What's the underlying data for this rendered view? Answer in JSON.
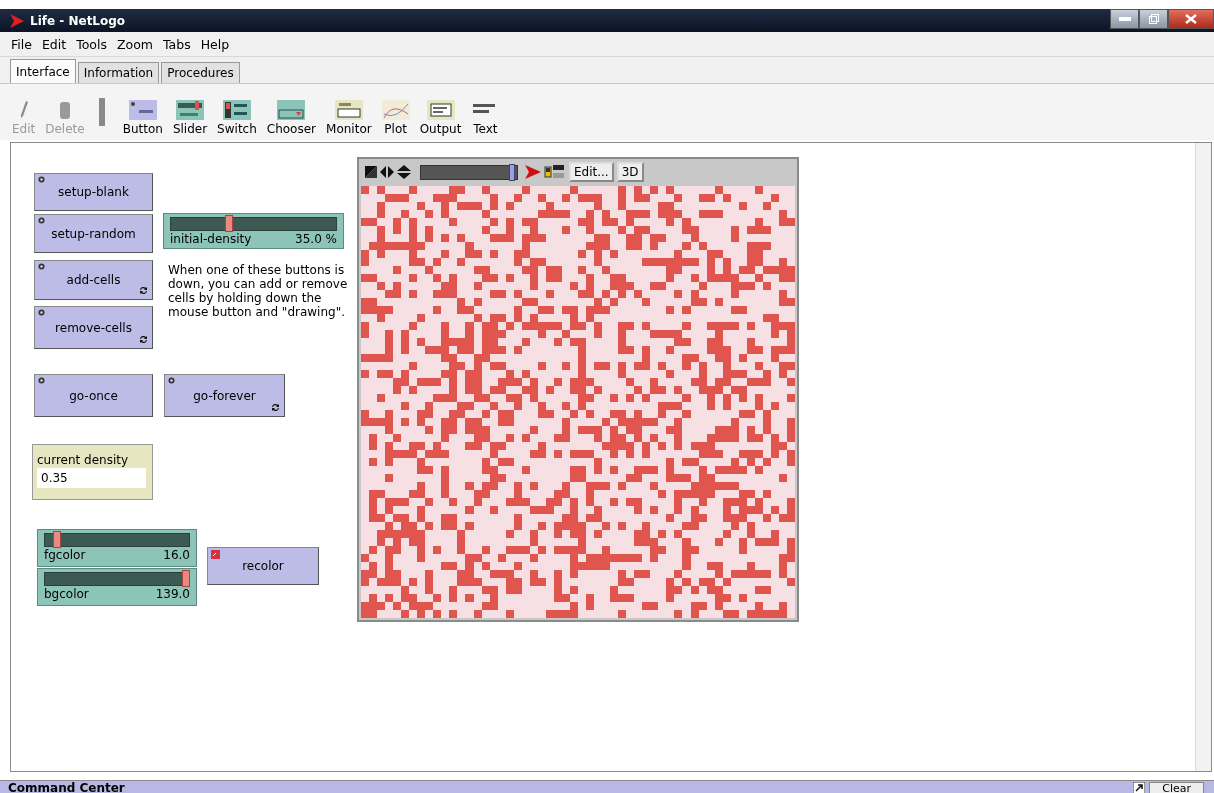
{
  "window": {
    "title": "Life - NetLogo"
  },
  "menu": [
    "File",
    "Edit",
    "Tools",
    "Zoom",
    "Tabs",
    "Help"
  ],
  "tabs": [
    {
      "label": "Interface",
      "selected": true
    },
    {
      "label": "Information",
      "selected": false
    },
    {
      "label": "Procedures",
      "selected": false
    }
  ],
  "toolbar": [
    {
      "kind": "edit",
      "label": "Edit",
      "disabled": true
    },
    {
      "kind": "delete",
      "label": "Delete",
      "disabled": true
    },
    {
      "kind": "button",
      "label": "Button",
      "disabled": false
    },
    {
      "kind": "slider",
      "label": "Slider",
      "disabled": false
    },
    {
      "kind": "switch",
      "label": "Switch",
      "disabled": false
    },
    {
      "kind": "chooser",
      "label": "Chooser",
      "disabled": false
    },
    {
      "kind": "monitor",
      "label": "Monitor",
      "disabled": false
    },
    {
      "kind": "plot",
      "label": "Plot",
      "disabled": false
    },
    {
      "kind": "output",
      "label": "Output",
      "disabled": false
    },
    {
      "kind": "text",
      "label": "Text",
      "disabled": false
    }
  ],
  "widgets": [
    {
      "kind": "button",
      "label": "setup-blank",
      "patches": false,
      "forever": false
    },
    {
      "kind": "button",
      "label": "setup-random",
      "patches": false,
      "forever": false
    },
    {
      "kind": "slider",
      "label": "initial-density",
      "value": "35.0 %",
      "level": 0.35
    },
    {
      "kind": "button",
      "label": "add-cells",
      "patches": false,
      "forever": true
    },
    {
      "kind": "note",
      "text": "When one of these buttons is down, you can add or remove cells by holding down the mouse button and \"drawing\"."
    },
    {
      "kind": "button",
      "label": "remove-cells",
      "patches": false,
      "forever": true
    },
    {
      "kind": "button",
      "label": "go-once",
      "patches": false,
      "forever": false
    },
    {
      "kind": "button",
      "label": "go-forever",
      "patches": false,
      "forever": true
    },
    {
      "kind": "monitor",
      "label": "current density",
      "value": "0.35"
    },
    {
      "kind": "slider",
      "label": "fgcolor",
      "value": "16.0",
      "level": 0.08
    },
    {
      "kind": "slider",
      "label": "bgcolor",
      "value": "139.0",
      "level": 0.98
    },
    {
      "kind": "button",
      "label": "recolor",
      "patches": true,
      "forever": false
    },
    {
      "kind": "view",
      "speed": {
        "level": 0.95
      },
      "view_updates": true,
      "buttons": [
        "Edit...",
        "3D"
      ]
    }
  ],
  "command_center": {
    "title": "Command Center",
    "buttons": [
      "Clear"
    ]
  }
}
